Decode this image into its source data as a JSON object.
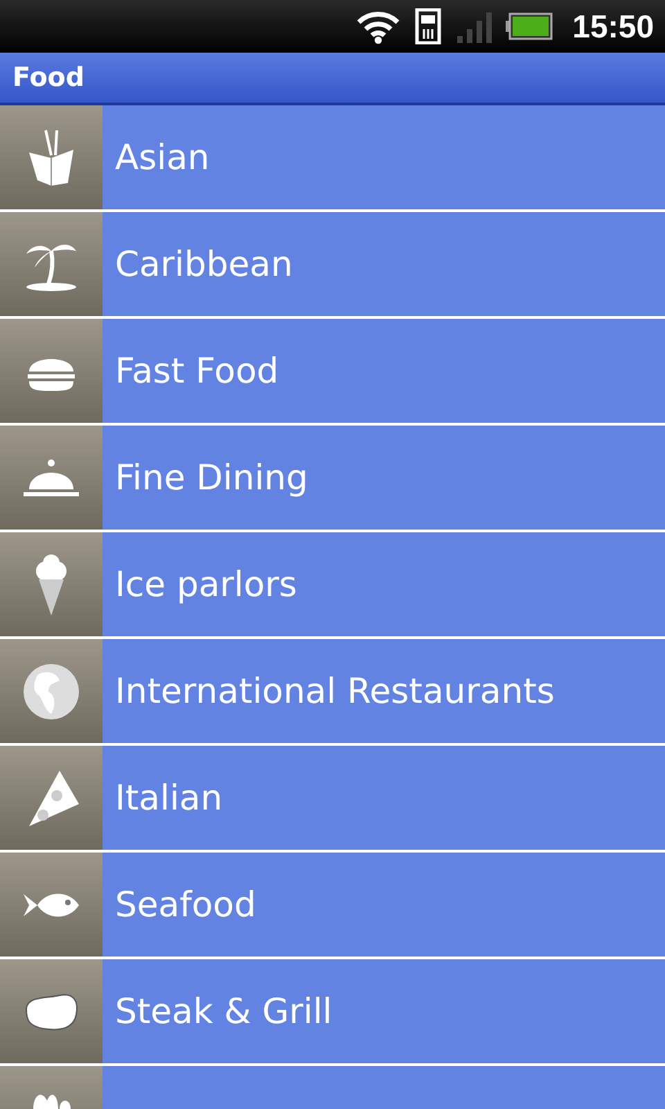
{
  "status_bar": {
    "time": "15:50"
  },
  "title_bar": {
    "title": "Food"
  },
  "items": [
    {
      "label": "Asian"
    },
    {
      "label": "Caribbean"
    },
    {
      "label": "Fast Food"
    },
    {
      "label": "Fine Dining"
    },
    {
      "label": "Ice parlors"
    },
    {
      "label": "International Restaurants"
    },
    {
      "label": "Italian"
    },
    {
      "label": "Seafood"
    },
    {
      "label": "Steak & Grill"
    }
  ]
}
